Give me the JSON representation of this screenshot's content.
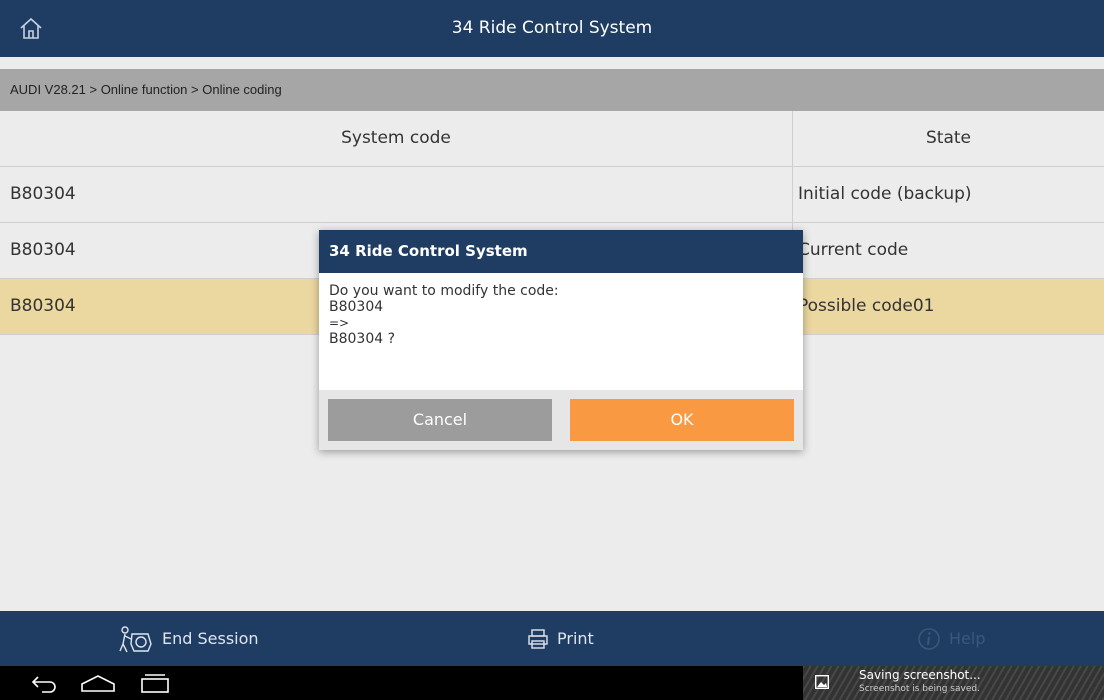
{
  "header": {
    "title": "34 Ride Control System",
    "home_icon": "home-icon"
  },
  "breadcrumb": "AUDI V28.21 > Online function > Online coding",
  "table": {
    "columns": [
      "System code",
      "State"
    ],
    "rows": [
      {
        "code": "B80304",
        "state": "Initial code (backup)",
        "highlight": false
      },
      {
        "code": "B80304",
        "state": "Current code",
        "highlight": false
      },
      {
        "code": "B80304",
        "state": "Possible code01",
        "highlight": true
      }
    ],
    "highlight_color": "#ebd7a0"
  },
  "dialog": {
    "title": "34 Ride Control System",
    "line1": "Do you want to modify the code:",
    "line2": "B80304",
    "line3": "=>",
    "line4": "B80304 ?",
    "cancel_label": "Cancel",
    "ok_label": "OK",
    "ok_color": "#f99a43"
  },
  "bottom_bar": {
    "end_session": "End Session",
    "print": "Print",
    "help": "Help"
  },
  "toast": {
    "title": "Saving screenshot...",
    "subtitle": "Screenshot is being saved."
  },
  "colors": {
    "primary": "#1f3d63",
    "background": "#ececec"
  }
}
